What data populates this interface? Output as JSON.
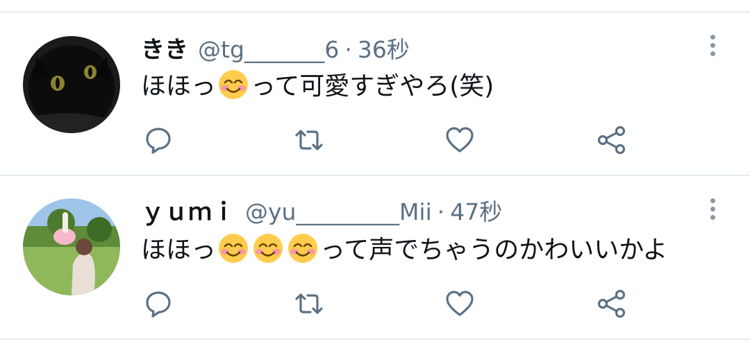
{
  "tweets": [
    {
      "display_name": "きき",
      "handle": "@tg_______6",
      "separator": "·",
      "time": "36秒",
      "text_before": "ほほっ",
      "emoji": [
        "smiling-face-with-blush-emoji"
      ],
      "text_after": "って可愛すぎやろ(笑)",
      "avatar": "black-cat-photo"
    },
    {
      "display_name": "ｙｕｍｉ",
      "handle": "@yu_________Mii",
      "separator": "·",
      "time": "47秒",
      "text_before": "ほほっ",
      "emoji": [
        "smiling-face-with-blush-emoji",
        "smiling-face-with-blush-emoji",
        "smiling-face-with-blush-emoji"
      ],
      "text_after": "って声でちゃうのかわいいかよ",
      "avatar": "person-in-park-photo"
    }
  ],
  "actions": [
    "reply-icon",
    "retweet-icon",
    "like-icon",
    "share-icon"
  ],
  "colors": {
    "text": "#0f1419",
    "secondary": "#5b7083",
    "icon": "#5b7083",
    "divider": "#e6ecf0"
  }
}
